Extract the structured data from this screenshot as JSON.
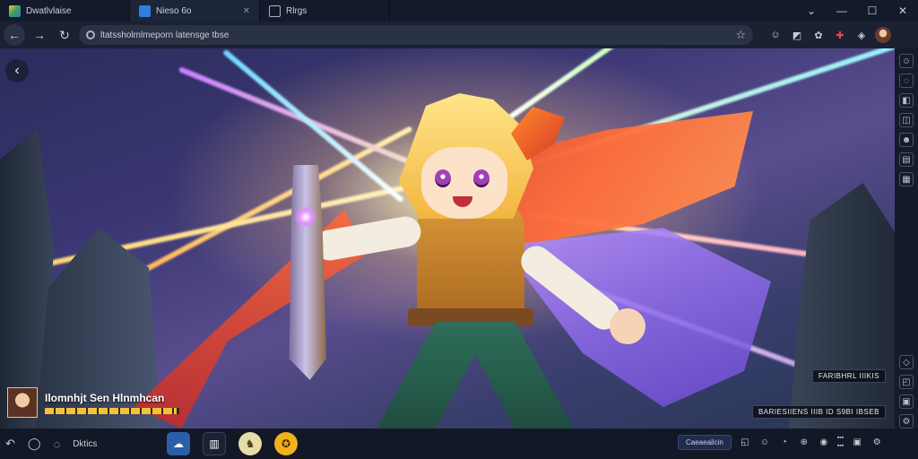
{
  "tabs": [
    {
      "label": "Dwatlvlaise",
      "icon": "app-icon",
      "active": false
    },
    {
      "label": "Nieso 6o",
      "icon": "blue-app-icon",
      "active": true
    },
    {
      "label": "Rlrgs",
      "icon": "page-icon",
      "active": false
    }
  ],
  "address": {
    "url": "ltatssholmlmeporn latensge tbse"
  },
  "player": {
    "name": "Ilomnhjt Sen Hlnmhcan",
    "hp_fraction": 0.98
  },
  "stats": {
    "top": "FARIBHRL IIIKIS",
    "bottom": "BARIESIIENS   IIIB  ID   S9BI  IBSEB"
  },
  "taskbar": {
    "label": "Dktics",
    "pill": "Caeaeailcin"
  },
  "colors": {
    "accent": "#2a5fa8",
    "hp": "#f4c23a"
  }
}
